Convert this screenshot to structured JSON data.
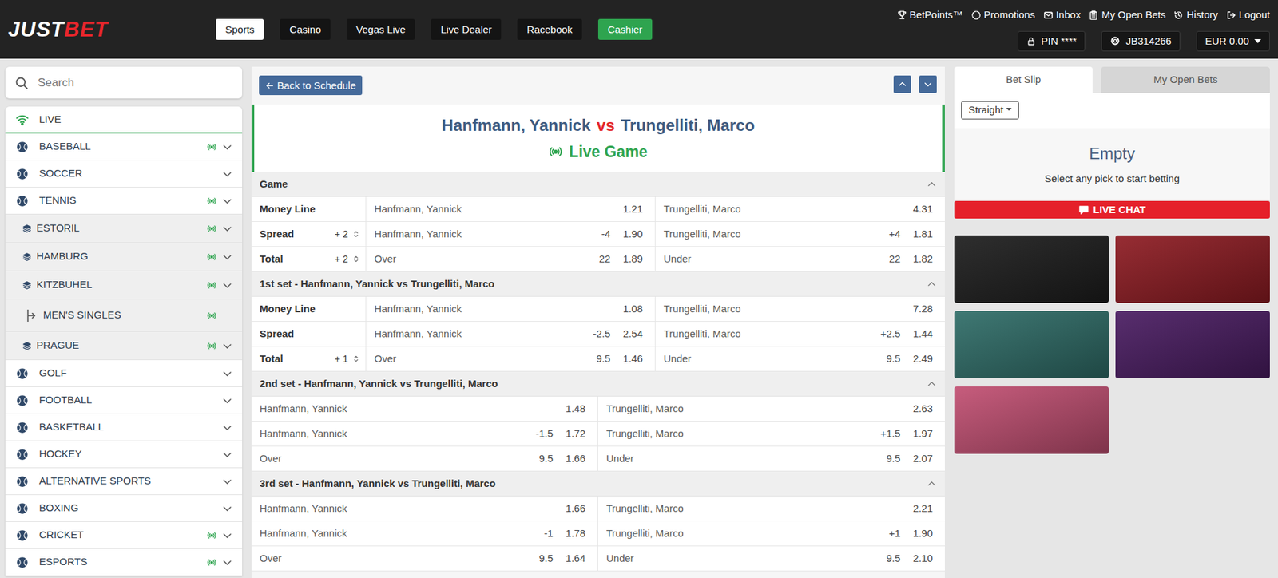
{
  "brand": {
    "first": "JUST",
    "second": "BET"
  },
  "nav": [
    {
      "label": "Sports",
      "selected": true
    },
    {
      "label": "Casino",
      "selected": false
    },
    {
      "label": "Vegas Live",
      "selected": false
    },
    {
      "label": "Live Dealer",
      "selected": false
    },
    {
      "label": "Racebook",
      "selected": false
    }
  ],
  "cashier": {
    "label": "Cashier"
  },
  "account_links": [
    "BetPoints™",
    "Promotions",
    "Inbox",
    "My Open Bets",
    "History",
    "Logout"
  ],
  "account": {
    "pin": "PIN ****",
    "user": "JB314266",
    "balance": "EUR 0.00"
  },
  "search": {
    "placeholder": "Search"
  },
  "sidebar": {
    "items": [
      {
        "label": "LIVE",
        "kind": "live",
        "live": false,
        "selected": true
      },
      {
        "label": "BASEBALL",
        "kind": "sport",
        "live": true,
        "selected": false
      },
      {
        "label": "SOCCER",
        "kind": "sport",
        "live": false,
        "selected": false
      },
      {
        "label": "TENNIS",
        "kind": "sport",
        "live": true,
        "selected": false
      },
      {
        "label": "ESTORIL",
        "kind": "league",
        "live": true,
        "selected": false
      },
      {
        "label": "HAMBURG",
        "kind": "league",
        "live": true,
        "selected": false
      },
      {
        "label": "KITZBUHEL",
        "kind": "league",
        "live": true,
        "selected": false
      },
      {
        "label": "MEN'S SINGLES",
        "kind": "market",
        "live": true,
        "selected": false
      },
      {
        "label": "PRAGUE",
        "kind": "league",
        "live": true,
        "selected": false
      },
      {
        "label": "GOLF",
        "kind": "sport",
        "live": false,
        "selected": false
      },
      {
        "label": "FOOTBALL",
        "kind": "sport",
        "live": false,
        "selected": false
      },
      {
        "label": "BASKETBALL",
        "kind": "sport",
        "live": false,
        "selected": false
      },
      {
        "label": "HOCKEY",
        "kind": "sport",
        "live": false,
        "selected": false
      },
      {
        "label": "ALTERNATIVE SPORTS",
        "kind": "sport",
        "live": false,
        "selected": false
      },
      {
        "label": "BOXING",
        "kind": "sport",
        "live": false,
        "selected": false
      },
      {
        "label": "CRICKET",
        "kind": "sport",
        "live": true,
        "selected": false
      },
      {
        "label": "ESPORTS",
        "kind": "sport",
        "live": true,
        "selected": false
      }
    ]
  },
  "match": {
    "back": "Back to Schedule",
    "home": "Hanfmann, Yannick",
    "vs": "vs",
    "away": "Trungelliti, Marco",
    "status": "Live Game"
  },
  "sections": [
    {
      "title": "Game",
      "kind": "labeled",
      "expanded": true,
      "rows": [
        {
          "label": "Money Line",
          "home": {
            "name": "Hanfmann, Yannick",
            "odds": "1.21"
          },
          "away": {
            "name": "Trungelliti, Marco",
            "odds": "4.31"
          }
        },
        {
          "label": "Spread",
          "adjust": "+ 2",
          "home": {
            "name": "Hanfmann, Yannick",
            "line": "-4",
            "odds": "1.90"
          },
          "away": {
            "name": "Trungelliti, Marco",
            "line": "+4",
            "odds": "1.81"
          }
        },
        {
          "label": "Total",
          "adjust": "+ 2",
          "home": {
            "name": "Over",
            "line": "22",
            "odds": "1.89"
          },
          "away": {
            "name": "Under",
            "line": "22",
            "odds": "1.82"
          }
        }
      ]
    },
    {
      "title": "1st set - Hanfmann, Yannick vs Trungelliti, Marco",
      "kind": "labeled",
      "expanded": true,
      "rows": [
        {
          "label": "Money Line",
          "home": {
            "name": "Hanfmann, Yannick",
            "odds": "1.08"
          },
          "away": {
            "name": "Trungelliti, Marco",
            "odds": "7.28"
          }
        },
        {
          "label": "Spread",
          "home": {
            "name": "Hanfmann, Yannick",
            "line": "-2.5",
            "odds": "2.54"
          },
          "away": {
            "name": "Trungelliti, Marco",
            "line": "+2.5",
            "odds": "1.44"
          }
        },
        {
          "label": "Total",
          "adjust": "+ 1",
          "home": {
            "name": "Over",
            "line": "9.5",
            "odds": "1.46"
          },
          "away": {
            "name": "Under",
            "line": "9.5",
            "odds": "2.49"
          }
        }
      ]
    },
    {
      "title": "2nd set - Hanfmann, Yannick vs Trungelliti, Marco",
      "kind": "compact",
      "expanded": true,
      "rows": [
        {
          "home": {
            "name": "Hanfmann, Yannick",
            "odds": "1.48"
          },
          "away": {
            "name": "Trungelliti, Marco",
            "odds": "2.63"
          }
        },
        {
          "home": {
            "name": "Hanfmann, Yannick",
            "line": "-1.5",
            "odds": "1.72"
          },
          "away": {
            "name": "Trungelliti, Marco",
            "line": "+1.5",
            "odds": "1.97"
          }
        },
        {
          "home": {
            "name": "Over",
            "line": "9.5",
            "odds": "1.66"
          },
          "away": {
            "name": "Under",
            "line": "9.5",
            "odds": "2.07"
          }
        }
      ]
    },
    {
      "title": "3rd set - Hanfmann, Yannick vs Trungelliti, Marco",
      "kind": "compact",
      "expanded": true,
      "rows": [
        {
          "home": {
            "name": "Hanfmann, Yannick",
            "odds": "1.66"
          },
          "away": {
            "name": "Trungelliti, Marco",
            "odds": "2.21"
          }
        },
        {
          "home": {
            "name": "Hanfmann, Yannick",
            "line": "-1",
            "odds": "1.78"
          },
          "away": {
            "name": "Trungelliti, Marco",
            "line": "+1",
            "odds": "1.90"
          }
        },
        {
          "home": {
            "name": "Over",
            "line": "9.5",
            "odds": "1.64"
          },
          "away": {
            "name": "Under",
            "line": "9.5",
            "odds": "2.10"
          }
        }
      ]
    }
  ],
  "betslip": {
    "tabs": [
      {
        "label": "Bet Slip",
        "selected": true
      },
      {
        "label": "My Open Bets",
        "selected": false
      }
    ],
    "bet_type": "Straight",
    "empty_title": "Empty",
    "empty_text": "Select any pick to start betting"
  },
  "live_chat": "LIVE CHAT",
  "promos": [
    {
      "color": "#1d1d1d"
    },
    {
      "color": "#8e1b22"
    },
    {
      "color": "#2f6d68"
    },
    {
      "color": "#4a1c62"
    },
    {
      "color": "#c24f72"
    }
  ]
}
